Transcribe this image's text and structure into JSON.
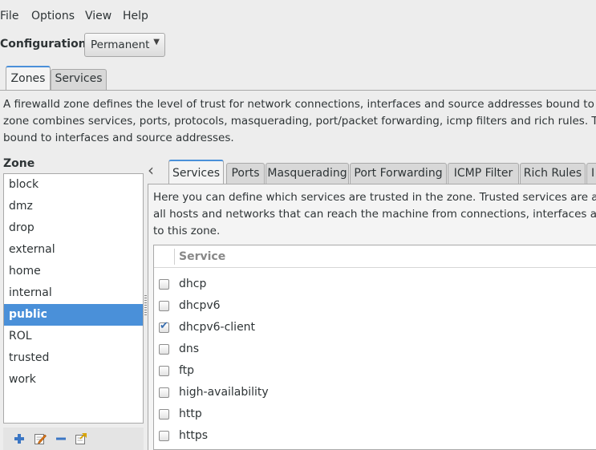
{
  "menu": [
    "File",
    "Options",
    "View",
    "Help"
  ],
  "config": {
    "label": "Configuration:",
    "value": "Permanent"
  },
  "top_tabs": [
    "Zones",
    "Services"
  ],
  "description": [
    "A firewalld zone defines the level of trust for network connections, interfaces and source addresses bound to the",
    "zone combines services, ports, protocols, masquerading, port/packet forwarding, icmp filters and rich rules. The z",
    "bound to interfaces and source addresses."
  ],
  "zone_panel": {
    "title": "Zone",
    "zones": [
      "block",
      "dmz",
      "drop",
      "external",
      "home",
      "internal",
      "public",
      "ROL",
      "trusted",
      "work"
    ],
    "selected": "public"
  },
  "sub_tabs": [
    "Services",
    "Ports",
    "Masquerading",
    "Port Forwarding",
    "ICMP Filter",
    "Rich Rules",
    "I"
  ],
  "services_desc": [
    "Here you can define which services are trusted in the zone. Trusted services are acce",
    "all hosts and networks that can reach the machine from connections, interfaces and s",
    "to this zone."
  ],
  "service_table": {
    "column": "Service",
    "rows": [
      {
        "name": "dhcp",
        "checked": false
      },
      {
        "name": "dhcpv6",
        "checked": false
      },
      {
        "name": "dhcpv6-client",
        "checked": true
      },
      {
        "name": "dns",
        "checked": false
      },
      {
        "name": "ftp",
        "checked": false
      },
      {
        "name": "high-availability",
        "checked": false
      },
      {
        "name": "http",
        "checked": false
      },
      {
        "name": "https",
        "checked": false
      }
    ]
  },
  "colors": {
    "accent": "#4a90d9",
    "background": "#ededed"
  },
  "icons": [
    "add-icon",
    "edit-icon",
    "remove-icon",
    "load-defaults-icon",
    "chevron-left-icon",
    "chevron-down-icon"
  ]
}
